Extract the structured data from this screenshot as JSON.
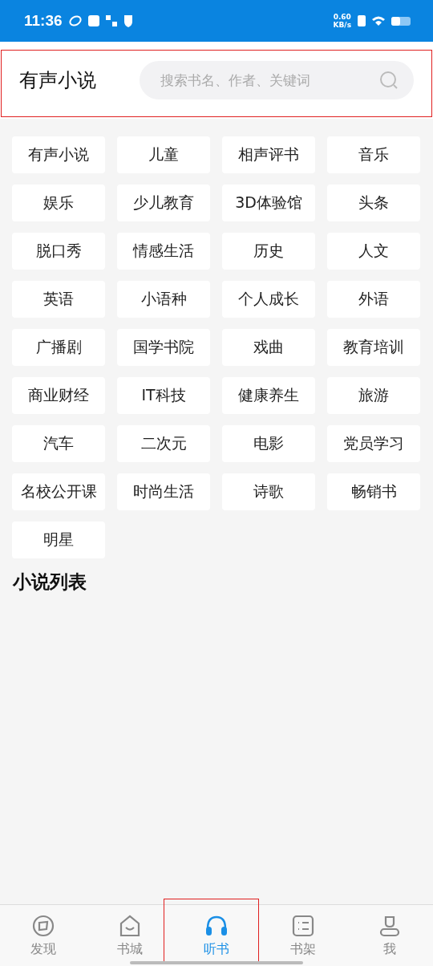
{
  "status_bar": {
    "time": "11:36",
    "speed": "0.60",
    "speed_unit": "KB/s"
  },
  "header": {
    "title": "有声小说",
    "search": {
      "placeholder": "搜索书名、作者、关键词"
    }
  },
  "categories": [
    "有声小说",
    "儿童",
    "相声评书",
    "音乐",
    "娱乐",
    "少儿教育",
    "3D体验馆",
    "头条",
    "脱口秀",
    "情感生活",
    "历史",
    "人文",
    "英语",
    "小语种",
    "个人成长",
    "外语",
    "广播剧",
    "国学书院",
    "戏曲",
    "教育培训",
    "商业财经",
    "IT科技",
    "健康养生",
    "旅游",
    "汽车",
    "二次元",
    "电影",
    "党员学习",
    "名校公开课",
    "时尚生活",
    "诗歌",
    "畅销书",
    "明星"
  ],
  "section_title": "小说列表",
  "bottom_nav": [
    {
      "label": "发现",
      "kind": "discover",
      "selected": false
    },
    {
      "label": "书城",
      "kind": "store",
      "selected": false
    },
    {
      "label": "听书",
      "kind": "listen",
      "selected": true
    },
    {
      "label": "书架",
      "kind": "shelf",
      "selected": false
    },
    {
      "label": "我",
      "kind": "me",
      "selected": false
    }
  ]
}
